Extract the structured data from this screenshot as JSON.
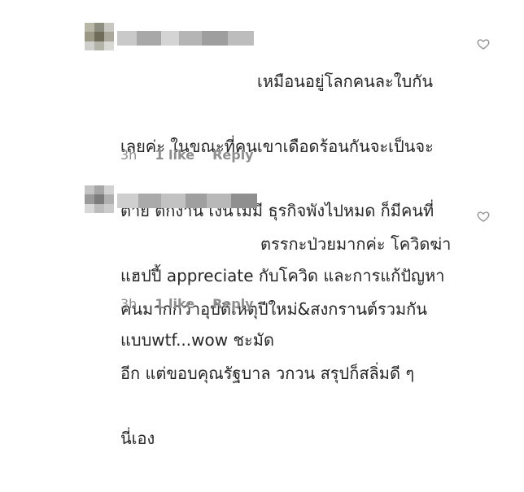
{
  "comments": [
    {
      "lines": [
        "เหมือนอยู่โลกคนละใบกัน",
        "เลยค่ะ ในขณะที่คนเขาเดือดร้อนกันจะเป็นจะ",
        "ตาย ตกงาน เงินไม่มี ธุรกิจพังไปหมด ก็มีคนที่",
        "แฮปปี้ appreciate กับโควิด และการแก้ปัญหา",
        "แบบwtf...wow ชะมัด"
      ],
      "time": "3h",
      "likes": "1 like",
      "reply": "Reply",
      "like_icon": "heart-outline-icon"
    },
    {
      "lines": [
        "ตรรกะป่วยมากค่ะ โควิดฆ่า",
        "คนมากกว่าอุบัติเหตุปีใหม่&สงกรานต์รวมกัน",
        "อีก แต่ขอบคุณรัฐบาล วกวน สรุปก็สลิ่มดี ๆ",
        "นี่เอง"
      ],
      "time": "3h",
      "likes": "1 like",
      "reply": "Reply",
      "like_icon": "heart-outline-icon"
    }
  ],
  "colors": {
    "text": "#262626",
    "meta": "#8e8e8e",
    "background": "#ffffff"
  }
}
